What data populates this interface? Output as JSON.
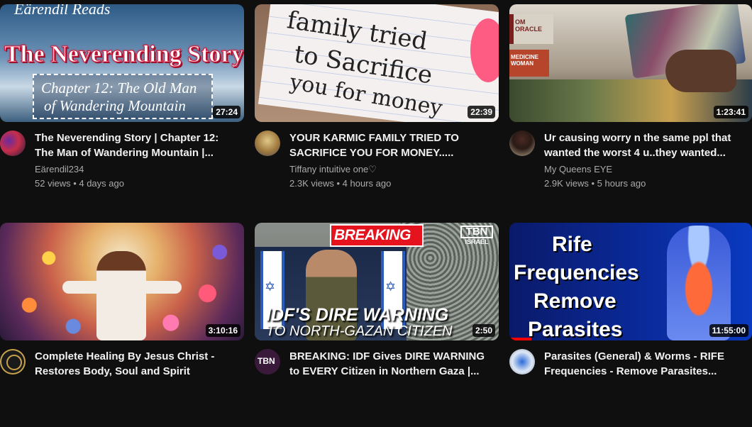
{
  "videos": [
    {
      "thumb_overlay": {
        "top": "Eärendil Reads",
        "title": "The Neverending Story",
        "subtitle_1": "Chapter 12: The Old Man",
        "subtitle_2": "of Wandering Mountain"
      },
      "duration": "27:24",
      "title": "The Neverending Story | Chapter 12: The Man of Wandering Mountain |...",
      "channel": "Eärendil234",
      "stats": "52 views • 4 days ago"
    },
    {
      "thumb_overlay": {
        "line_1": "family tried",
        "line_2": "to Sacrifice",
        "line_3": "you for money"
      },
      "duration": "22:39",
      "title": "YOUR KARMIC FAMILY TRIED TO SACRIFICE YOU FOR MONEY.....",
      "channel": "Tiffany intuitive one♡",
      "stats": "2.3K views • 4 hours ago"
    },
    {
      "thumb_overlay": {
        "book_1": "OM ORACLE",
        "book_2": "MEDICINE WOMAN"
      },
      "duration": "1:23:41",
      "title": "Ur causing worry n the same ppl that wanted the worst 4 u..they wanted...",
      "channel": "My Queens EYE",
      "stats": "2.9K views • 5 hours ago"
    },
    {
      "thumb_overlay": {},
      "duration": "3:10:16",
      "title": "Complete Healing By Jesus Christ - Restores Body, Soul and Spirit",
      "channel": "",
      "stats": ""
    },
    {
      "thumb_overlay": {
        "banner": "BREAKING",
        "logo": "TBN",
        "logo_sub": "ISRAEL",
        "headline_1": "IDF'S DIRE WARNING",
        "headline_2": "TO NORTH-GAZAN CITIZEN"
      },
      "duration": "2:50",
      "title": "BREAKING: IDF Gives DIRE WARNING to EVERY Citizen in Northern Gaza |...",
      "channel": "",
      "stats": "",
      "avatar_text": "TBN"
    },
    {
      "thumb_overlay": {
        "line_1": "Rife",
        "line_2": "Frequencies",
        "line_3": "Remove",
        "line_4": "Parasites"
      },
      "duration": "11:55:00",
      "progress": 0.09,
      "title": "Parasites (General) & Worms - RIFE Frequencies - Remove Parasites...",
      "channel": "",
      "stats": ""
    }
  ],
  "colors": {
    "background": "#0f0f0f",
    "title": "#f1f1f1",
    "secondary": "#aaaaaa",
    "progress": "#ff0000"
  }
}
